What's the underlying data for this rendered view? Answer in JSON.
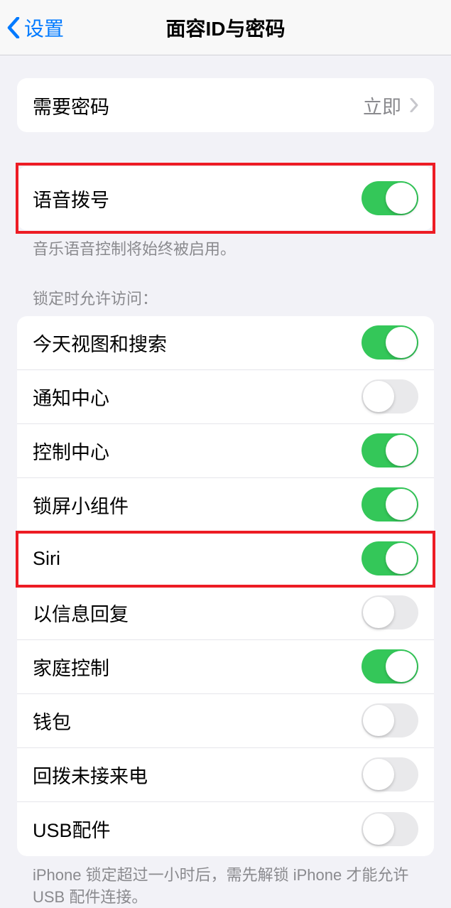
{
  "header": {
    "back_label": "设置",
    "title": "面容ID与密码"
  },
  "passcode_group": {
    "require_passcode": {
      "label": "需要密码",
      "value": "立即"
    }
  },
  "voice_dial": {
    "label": "语音拨号",
    "on": true,
    "footer": "音乐语音控制将始终被启用。"
  },
  "allow_access_header": "锁定时允许访问：",
  "allow_access_items": [
    {
      "label": "今天视图和搜索",
      "on": true
    },
    {
      "label": "通知中心",
      "on": false
    },
    {
      "label": "控制中心",
      "on": true
    },
    {
      "label": "锁屏小组件",
      "on": true
    },
    {
      "label": "Siri",
      "on": true
    },
    {
      "label": "以信息回复",
      "on": false
    },
    {
      "label": "家庭控制",
      "on": true
    },
    {
      "label": "钱包",
      "on": false
    },
    {
      "label": "回拨未接来电",
      "on": false
    },
    {
      "label": "USB配件",
      "on": false
    }
  ],
  "allow_access_footer": "iPhone 锁定超过一小时后，需先解锁 iPhone 才能允许USB 配件连接。"
}
